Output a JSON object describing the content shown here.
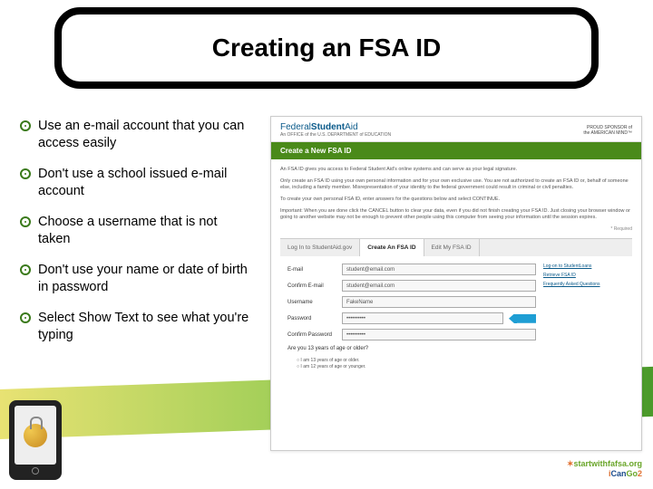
{
  "title": "Creating an FSA ID",
  "bullets": [
    "Use an e-mail account that you can access easily",
    "Don't use a school issued e-mail account",
    "Choose a username that is not taken",
    "Don't use your name or date of birth in password",
    "Select Show Text to see what you're typing"
  ],
  "screenshot": {
    "logo_prefix": "Federal",
    "logo_main": "Student",
    "logo_suffix": "Aid",
    "logo_sub": "An OFFICE of the U.S. DEPARTMENT of EDUCATION",
    "sponsor_line1": "PROUD SPONSOR of",
    "sponsor_line2": "the AMERICAN MIND™",
    "ribbon": "Create a New FSA ID",
    "intro1": "An FSA ID gives you access to Federal Student Aid's online systems and can serve as your legal signature.",
    "intro2": "Only create an FSA ID using your own personal information and for your own exclusive use. You are not authorized to create an FSA ID or, behalf of someone else, including a family member. Misrepresentation of your identity to the federal government could result in criminal or civil penalties.",
    "intro3": "To create your own personal FSA ID, enter answers for the questions below and select CONTINUE.",
    "intro4": "Important: When you are done click the CANCEL button to clear your data, even if you did not finish creating your FSA ID. Just closing your browser window or going to another website may not be enough to prevent other people using this computer from seeing your information until the session expires.",
    "required": "* Required",
    "tabs": [
      "Log In to StudentAid.gov",
      "Create An FSA ID",
      "Edit My FSA ID"
    ],
    "active_tab": 1,
    "fields": {
      "email_label": "E-mail",
      "email_value": "student@email.com",
      "confirm_email_label": "Confirm E-mail",
      "confirm_email_value": "student@email.com",
      "username_label": "Username",
      "username_value": "FakeName",
      "password_label": "Password",
      "password_value": "••••••••••",
      "confirm_password_label": "Confirm Password",
      "confirm_password_value": "••••••••••",
      "age_label": "Are you 13 years of age or older?",
      "age_opt1": "I am 13 years of age or older.",
      "age_opt2": "I am 12 years of age or younger."
    },
    "side_links": [
      "Log-on to StudentLoans",
      "Retrieve FSA ID",
      "Frequently Asked Questions"
    ]
  },
  "logos": {
    "fafsa": "startwithfafsa.org",
    "cango_i": "i",
    "cango_can": "Can",
    "cango_go": "Go",
    "cango_2": "2"
  }
}
